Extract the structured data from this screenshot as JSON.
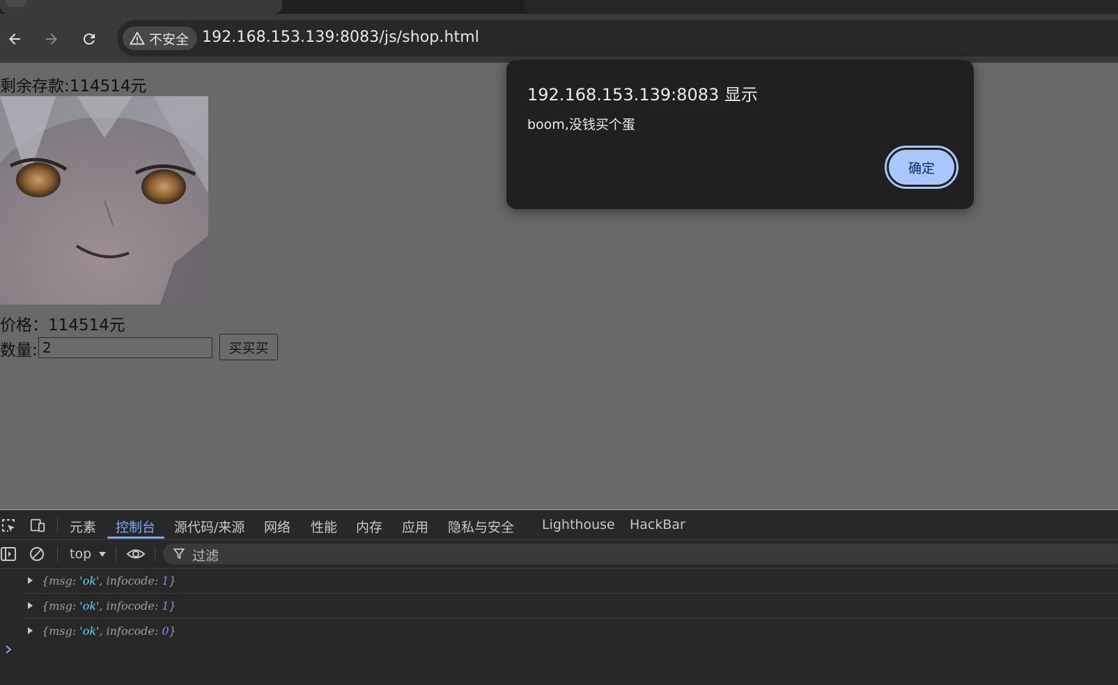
{
  "browser": {
    "security_label": "不安全",
    "url": "192.168.153.139:8083/js/shop.html"
  },
  "page": {
    "balance": "剩余存款:114514元",
    "price": "价格：114514元",
    "quantity_label": "数量:",
    "quantity_value": "2",
    "buy_label": "买买买"
  },
  "alert": {
    "title": "192.168.153.139:8083 显示",
    "message": "boom,没钱买个蛋",
    "ok_label": "确定"
  },
  "devtools": {
    "tabs": [
      "元素",
      "控制台",
      "源代码/来源",
      "网络",
      "性能",
      "内存",
      "应用",
      "隐私与安全",
      "Lighthouse",
      "HackBar"
    ],
    "active_tab": "控制台",
    "context": "top",
    "filter_placeholder": "过滤",
    "logs": [
      {
        "msg": "'ok'",
        "infocode": "1"
      },
      {
        "msg": "'ok'",
        "infocode": "1"
      },
      {
        "msg": "'ok'",
        "infocode": "0"
      }
    ]
  },
  "colors": {
    "accent": "#7cacf8",
    "button_primary": "#a8c7fa",
    "string_token": "#5cd5fb",
    "number_token": "#9980ff"
  }
}
